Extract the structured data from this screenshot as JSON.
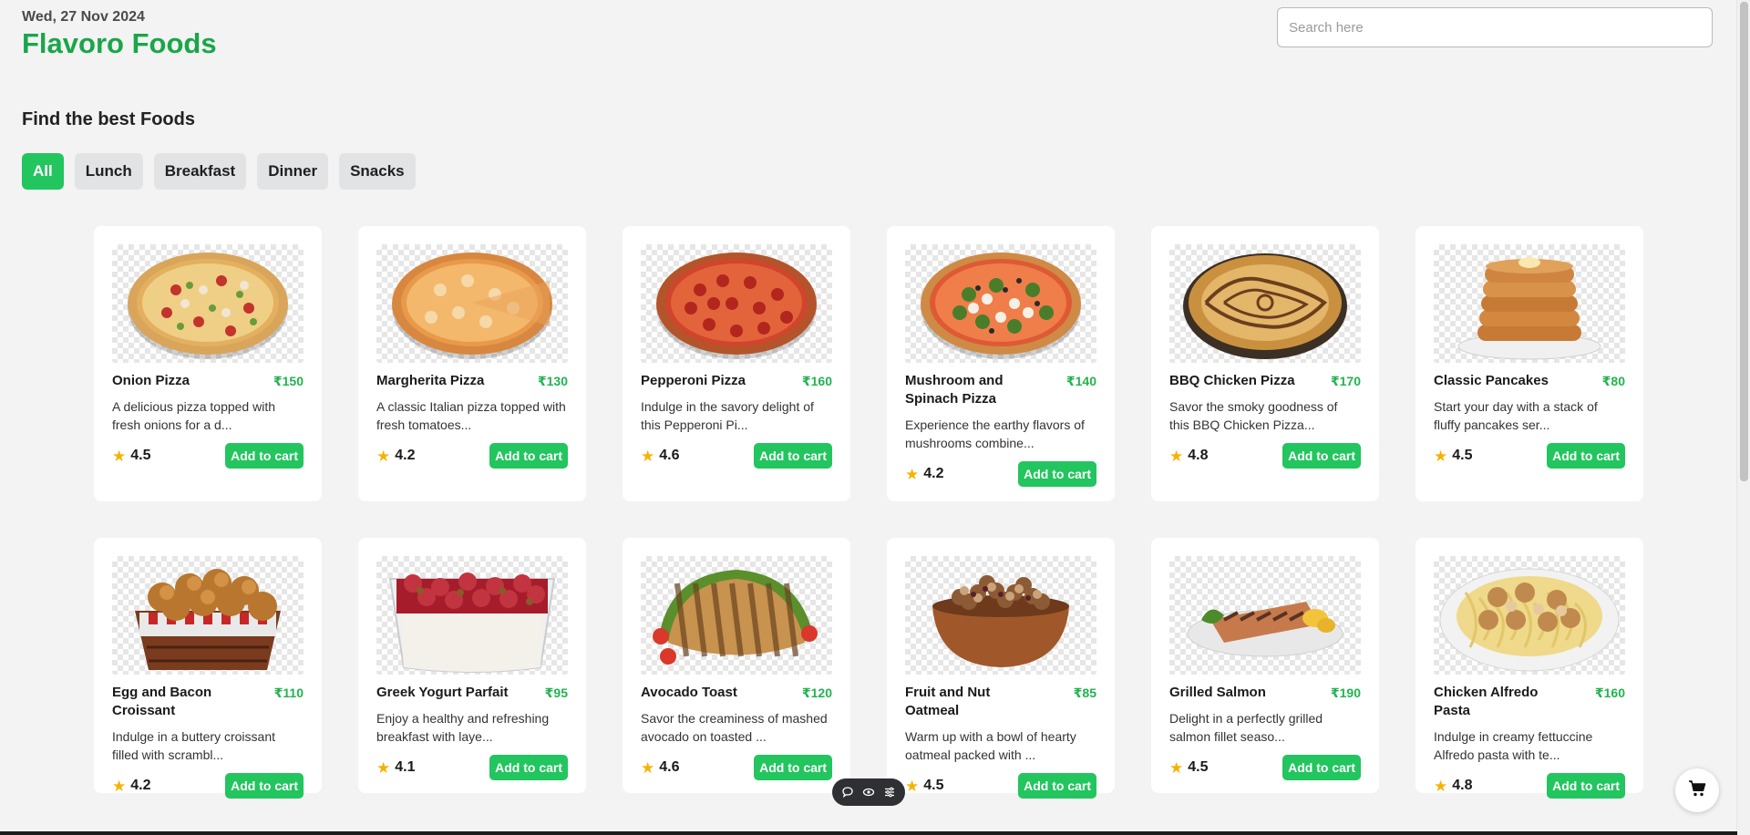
{
  "header": {
    "date": "Wed, 27 Nov 2024",
    "brand": "Flavoro Foods",
    "search_placeholder": "Search here"
  },
  "section_title": "Find the best Foods",
  "filters": [
    {
      "label": "All",
      "active": true
    },
    {
      "label": "Lunch",
      "active": false
    },
    {
      "label": "Breakfast",
      "active": false
    },
    {
      "label": "Dinner",
      "active": false
    },
    {
      "label": "Snacks",
      "active": false
    }
  ],
  "add_to_cart_label": "Add to cart",
  "colors": {
    "brand_green": "#1aa64a",
    "accent_green": "#22c55e",
    "price_green": "#22b34f",
    "star": "#f5b301"
  },
  "foods": [
    {
      "name": "Onion Pizza",
      "price": "₹150",
      "desc": "A delicious pizza topped with fresh onions for a d...",
      "rating": "4.5",
      "icon": "pizza-icon"
    },
    {
      "name": "Margherita Pizza",
      "price": "₹130",
      "desc": "A classic Italian pizza topped with fresh tomatoes...",
      "rating": "4.2",
      "icon": "pizza-icon"
    },
    {
      "name": "Pepperoni Pizza",
      "price": "₹160",
      "desc": "Indulge in the savory delight of this Pepperoni Pi...",
      "rating": "4.6",
      "icon": "pizza-icon"
    },
    {
      "name": "Mushroom and Spinach Pizza",
      "price": "₹140",
      "desc": "Experience the earthy flavors of mushrooms combine...",
      "rating": "4.2",
      "icon": "pizza-icon"
    },
    {
      "name": "BBQ Chicken Pizza",
      "price": "₹170",
      "desc": "Savor the smoky goodness of this BBQ Chicken Pizza...",
      "rating": "4.8",
      "icon": "pizza-icon"
    },
    {
      "name": "Classic Pancakes",
      "price": "₹80",
      "desc": "Start your day with a stack of fluffy pancakes ser...",
      "rating": "4.5",
      "icon": "pancakes-icon"
    },
    {
      "name": "Egg and Bacon Croissant",
      "price": "₹110",
      "desc": "Indulge in a buttery croissant filled with scrambl...",
      "rating": "4.2",
      "icon": "croissant-basket-icon"
    },
    {
      "name": "Greek Yogurt Parfait",
      "price": "₹95",
      "desc": "Enjoy a healthy and refreshing breakfast with laye...",
      "rating": "4.1",
      "icon": "parfait-icon"
    },
    {
      "name": "Avocado Toast",
      "price": "₹120",
      "desc": "Savor the creaminess of mashed avocado on toasted ...",
      "rating": "4.6",
      "icon": "toast-icon"
    },
    {
      "name": "Fruit and Nut Oatmeal",
      "price": "₹85",
      "desc": "Warm up with a bowl of hearty oatmeal packed with ...",
      "rating": "4.5",
      "icon": "oatmeal-bowl-icon"
    },
    {
      "name": "Grilled Salmon",
      "price": "₹190",
      "desc": "Delight in a perfectly grilled salmon fillet seaso...",
      "rating": "4.5",
      "icon": "salmon-plate-icon"
    },
    {
      "name": "Chicken Alfredo Pasta",
      "price": "₹160",
      "desc": "Indulge in creamy fettuccine Alfredo pasta with te...",
      "rating": "4.8",
      "icon": "pasta-plate-icon"
    }
  ],
  "toolbar_icons": [
    "chat-bubble-icon",
    "eye-icon",
    "sliders-icon"
  ],
  "cart_icon": "shopping-cart-icon"
}
